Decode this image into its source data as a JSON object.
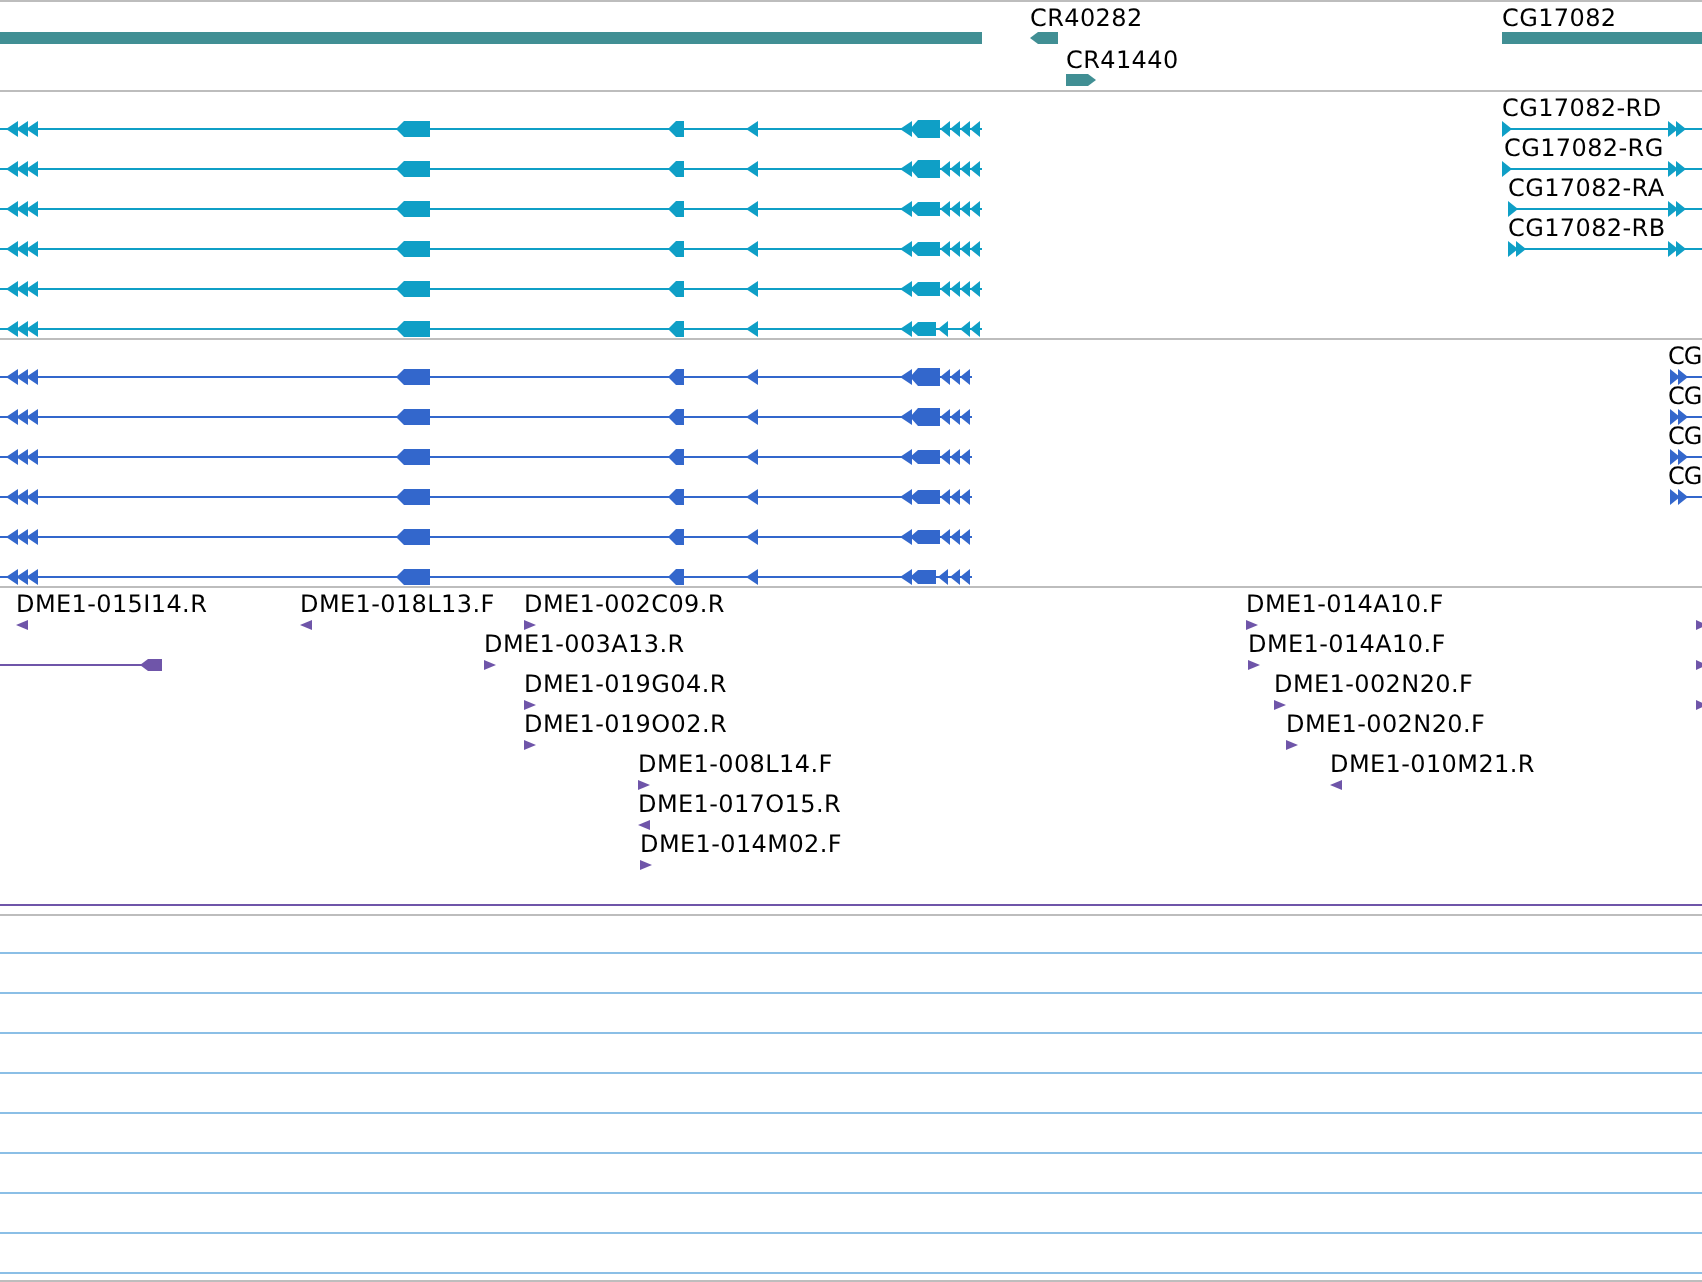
{
  "tracks": [
    {
      "kind": "genes",
      "features": [
        {
          "label": "CR40282",
          "reverse": true
        },
        {
          "label": "CR41440",
          "reverse": false
        },
        {
          "label": "CG17082"
        }
      ]
    },
    {
      "kind": "transcripts",
      "features": [
        {
          "label": "CG17082-RD",
          "reverse": false
        },
        {
          "label": "CG17082-RG",
          "reverse": false
        },
        {
          "label": "CG17082-RA",
          "reverse": false
        },
        {
          "label": "CG17082-RB",
          "reverse": false
        }
      ]
    },
    {
      "kind": "transcripts",
      "features": [
        {
          "label": "CG",
          "reverse": false
        },
        {
          "label": "CG",
          "reverse": false
        },
        {
          "label": "CG",
          "reverse": false
        },
        {
          "label": "CG",
          "reverse": false
        }
      ]
    },
    {
      "kind": "clones",
      "features": [
        {
          "label": "DME1-015I14.R",
          "reverse": true
        },
        {
          "label": "DME1-018L13.F",
          "reverse": true
        },
        {
          "label": "DME1-002C09.R",
          "reverse": false
        },
        {
          "label": "DME1-003A13.R",
          "reverse": false
        },
        {
          "label": "DME1-019G04.R",
          "reverse": false
        },
        {
          "label": "DME1-019O02.R",
          "reverse": false
        },
        {
          "label": "DME1-008L14.F",
          "reverse": false
        },
        {
          "label": "DME1-017O15.R",
          "reverse": true
        },
        {
          "label": "DME1-014M02.F",
          "reverse": false
        },
        {
          "label": "DME1-014A10.F",
          "reverse": false
        },
        {
          "label": "DME1-014A10.F",
          "reverse": false
        },
        {
          "label": "DME1-002N20.F",
          "reverse": false
        },
        {
          "label": "DME1-002N20.F",
          "reverse": false
        },
        {
          "label": "DME1-010M21.R",
          "reverse": true
        }
      ]
    }
  ]
}
